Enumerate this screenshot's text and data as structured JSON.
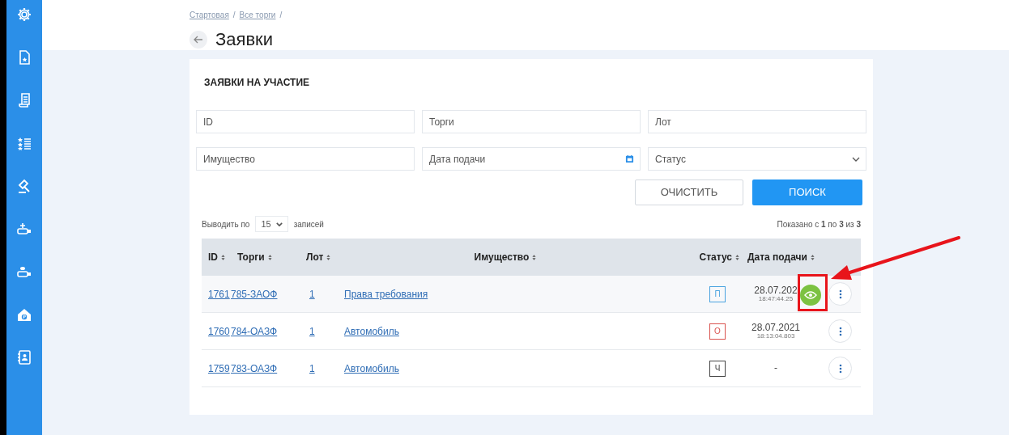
{
  "breadcrumbs": {
    "items": [
      "Стартовая",
      "Все торги"
    ],
    "separator": "/"
  },
  "title": "Заявки",
  "card": {
    "title": "ЗАЯВКИ НА УЧАСТИЕ",
    "filters": [
      {
        "kind": "text",
        "placeholder": "ID"
      },
      {
        "kind": "text",
        "placeholder": "Торги"
      },
      {
        "kind": "text",
        "placeholder": "Лот"
      },
      {
        "kind": "text",
        "placeholder": "Имущество"
      },
      {
        "kind": "date",
        "placeholder": "Дата подачи"
      },
      {
        "kind": "select",
        "placeholder": "Статус"
      }
    ],
    "buttons": [
      {
        "kind": "secondary",
        "label": "ОЧИСТИТЬ"
      },
      {
        "kind": "primary",
        "label": "ПОИСК"
      }
    ],
    "page_size": {
      "prefix": "Выводить по",
      "value": "15",
      "suffix": "записей"
    },
    "summary": "Показано с **1** по **3** из **3**",
    "table": {
      "columns": [
        {
          "label": "ID"
        },
        {
          "label": "Торги"
        },
        {
          "label": "Лот"
        },
        {
          "label": "Имущество"
        },
        {
          "label": "Статус"
        },
        {
          "label": "Дата подачи"
        }
      ],
      "rows": [
        {
          "id": "1761",
          "auction": "785-ЗАОФ",
          "lot": "1",
          "property": "Права требования",
          "status": {
            "label": "П",
            "color": "#4aa3df"
          },
          "date": "28.07.202",
          "time": "18:47:44.25",
          "hovered": true
        },
        {
          "id": "1760",
          "auction": "784-ОАЗФ",
          "lot": "1",
          "property": "Автомобиль",
          "status": {
            "label": "О",
            "color": "#d9534f"
          },
          "date": "28.07.2021",
          "time": "18:13:04.803",
          "hovered": false
        },
        {
          "id": "1759",
          "auction": "783-ОАЗФ",
          "lot": "1",
          "property": "Автомобиль",
          "status": {
            "label": "Ч",
            "color": "#444444"
          },
          "date": "-",
          "hovered": false
        }
      ]
    }
  }
}
